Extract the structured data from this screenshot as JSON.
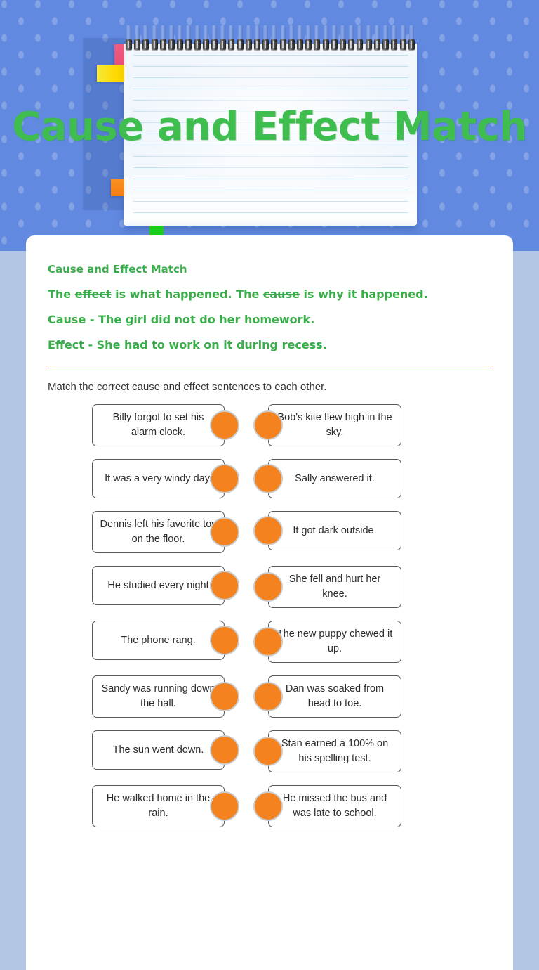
{
  "title": "Cause and Effect Match",
  "notebook": {
    "tabs": [
      {
        "name": "pink-tab",
        "color": "#e94f75"
      },
      {
        "name": "yellow-tab",
        "color": "#ffd900"
      },
      {
        "name": "orange-tab",
        "color": "#f57f10"
      },
      {
        "name": "green-tab",
        "color": "#19cf19"
      }
    ]
  },
  "colors": {
    "background_blue": "#6189e0",
    "panel_backdrop": "#b3c7e4",
    "green_text": "#38ad4a",
    "title_green": "#3fbd4f",
    "dot_orange": "#f3821f",
    "dot_ring": "#c9cacc",
    "card_border": "#58595b"
  },
  "lesson": {
    "heading": "Cause and Effect Match",
    "definition": {
      "part1": "The ",
      "bold1": "effect",
      "part2": " is what happened. The ",
      "bold2": "cause",
      "part3": " is why it happened."
    },
    "example_cause": "Cause - The girl did not do her homework.",
    "example_effect": "Effect - She had to work on it during recess."
  },
  "instructions": "Match the correct cause and effect sentences to each other.",
  "match_rows": [
    {
      "left": "Billy forgot to set his alarm clock.",
      "right": "Bob's kite flew high in the sky."
    },
    {
      "left": "It was a very windy day.",
      "right": "Sally answered it."
    },
    {
      "left": "Dennis left his favorite toy on the floor.",
      "right": "It got dark outside."
    },
    {
      "left": "He studied every night",
      "right": "She fell and hurt her knee."
    },
    {
      "left": "The phone rang.",
      "right": "The new puppy chewed it up."
    },
    {
      "left": "Sandy was running down the hall.",
      "right": "Dan was soaked from head to toe."
    },
    {
      "left": "The sun went down.",
      "right": "Stan earned a 100% on his spelling test."
    },
    {
      "left": "He walked home in the rain.",
      "right": "He missed the bus and was late to school."
    }
  ]
}
